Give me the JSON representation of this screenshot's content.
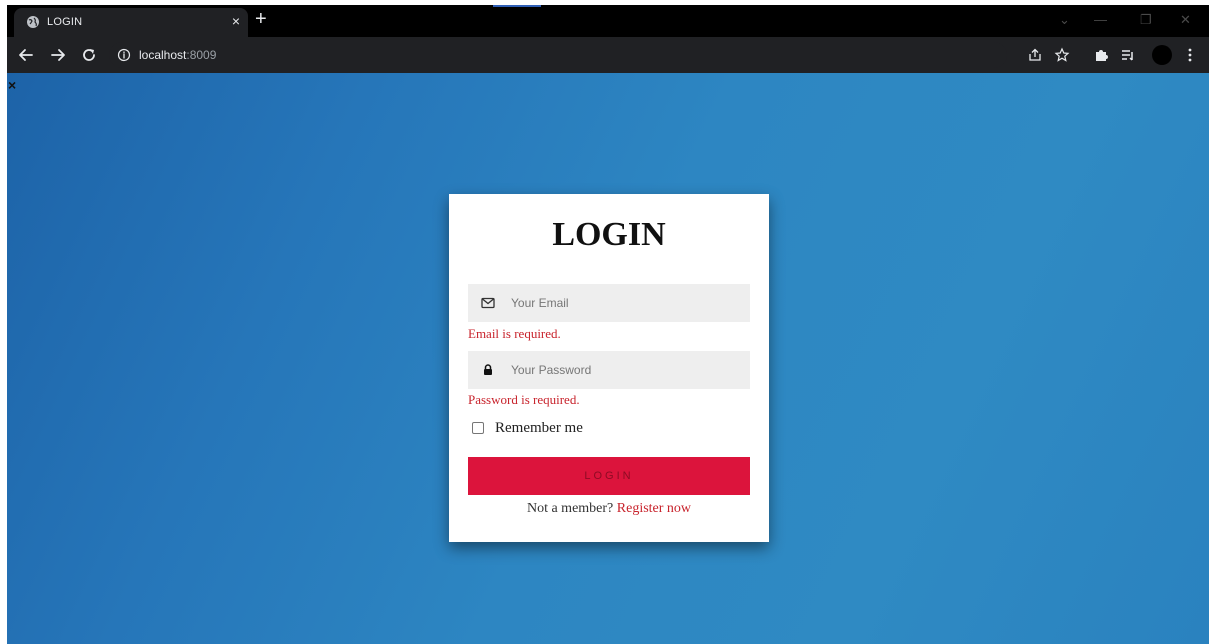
{
  "browser": {
    "tab": {
      "title": "LOGIN",
      "close_glyph": "×",
      "icon": "globe-icon"
    },
    "new_tab_glyph": "+",
    "window_controls": {
      "dropdown": "⌄",
      "minimize": "—",
      "restore": "❐",
      "close": "✕"
    },
    "nav": {
      "back_icon": "back-arrow-icon",
      "forward_icon": "forward-arrow-icon",
      "reload_icon": "reload-icon"
    },
    "address": {
      "host": "localhost",
      "port": ":8009",
      "info_icon": "info-icon"
    },
    "toolbar_icons": [
      "share-icon",
      "star-icon",
      "extensions-icon",
      "reading-list-icon",
      "profile-avatar",
      "kebab-menu-icon"
    ]
  },
  "page": {
    "close_glyph": "×",
    "background_colors": [
      "#1d63a8",
      "#2f8ac3"
    ]
  },
  "login_form": {
    "title": "LOGIN",
    "email": {
      "placeholder": "Your Email",
      "value": "",
      "icon": "envelope-icon",
      "error": "Email is required."
    },
    "password": {
      "placeholder": "Your Password",
      "value": "",
      "icon": "lock-icon",
      "error": "Password is required."
    },
    "remember_me": {
      "label": "Remember me",
      "checked": false
    },
    "submit_label": "LOGIN",
    "register_prompt": "Not a member?",
    "register_link": "Register now",
    "accent_color": "#dc143c",
    "error_color": "#c8232c"
  }
}
